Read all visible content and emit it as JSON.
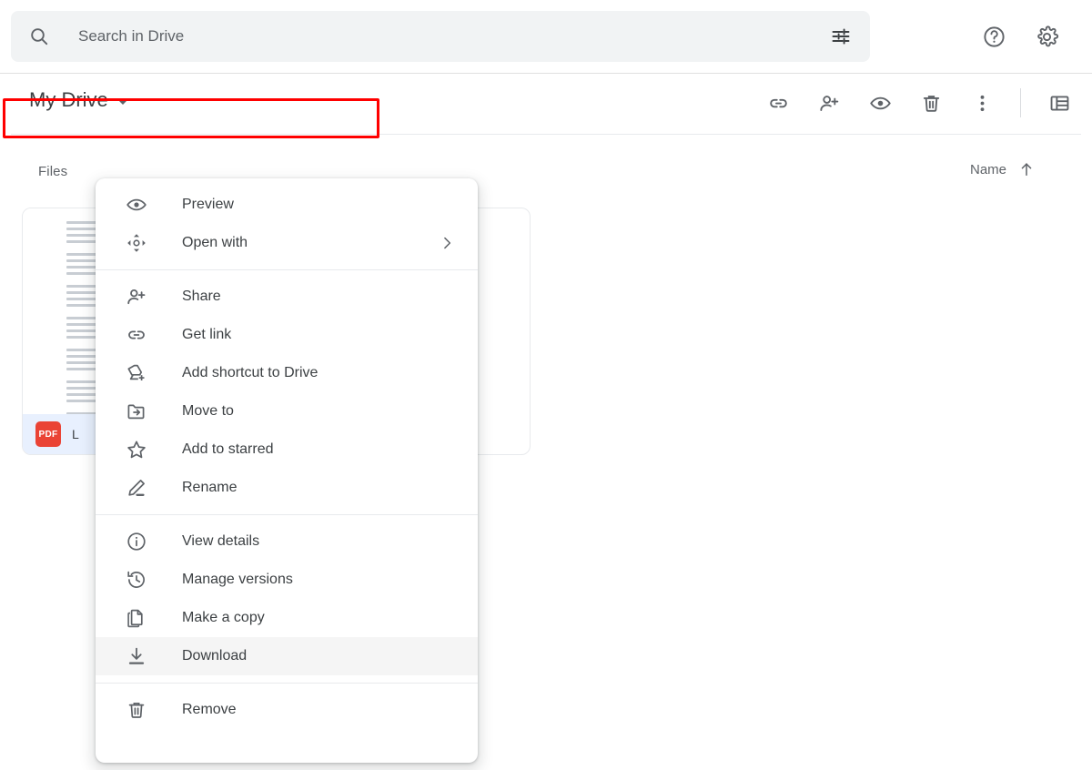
{
  "search": {
    "placeholder": "Search in Drive",
    "value": "",
    "icon": "search-icon",
    "filter_icon": "tune-filter-icon"
  },
  "header_actions": [
    {
      "name": "help-icon",
      "label": "Help"
    },
    {
      "name": "settings-icon",
      "label": "Settings"
    }
  ],
  "toolbar": {
    "breadcrumb": "My Drive",
    "caret_icon": "chevron-down-icon",
    "actions": [
      {
        "name": "get-link-icon",
        "label": "Get link"
      },
      {
        "name": "share-person-add-icon",
        "label": "Share"
      },
      {
        "name": "preview-eye-icon",
        "label": "Preview"
      },
      {
        "name": "trash-icon",
        "label": "Remove"
      },
      {
        "name": "more-vertical-icon",
        "label": "More actions"
      },
      {
        "name": "list-view-icon",
        "label": "List view"
      }
    ]
  },
  "content": {
    "section_title": "Files",
    "sort": {
      "label": "Name",
      "direction_icon": "arrow-up-icon"
    }
  },
  "files": [
    {
      "name": "L",
      "type_badge": "PDF",
      "selected": true,
      "thumbnail_paragraphs": [
        4,
        4,
        4,
        4,
        4,
        4,
        4,
        1
      ]
    },
    {
      "name": "",
      "type_badge": "",
      "selected": false,
      "thumbnail_paragraphs": []
    }
  ],
  "context_menu": {
    "groups": [
      {
        "items": [
          {
            "label": "Preview",
            "icon": "preview-eye-icon",
            "submenu": false
          },
          {
            "label": "Open with",
            "icon": "open-with-move-icon",
            "submenu": true
          }
        ]
      },
      {
        "items": [
          {
            "label": "Share",
            "icon": "share-person-add-icon",
            "submenu": false,
            "highlighted": true
          },
          {
            "label": "Get link",
            "icon": "link-icon",
            "submenu": false
          },
          {
            "label": "Add shortcut to Drive",
            "icon": "add-shortcut-icon",
            "submenu": false
          },
          {
            "label": "Move to",
            "icon": "move-to-folder-icon",
            "submenu": false
          },
          {
            "label": "Add to starred",
            "icon": "star-icon",
            "submenu": false
          },
          {
            "label": "Rename",
            "icon": "pencil-edit-icon",
            "submenu": false
          }
        ]
      },
      {
        "items": [
          {
            "label": "View details",
            "icon": "info-circle-icon",
            "submenu": false
          },
          {
            "label": "Manage versions",
            "icon": "history-clock-icon",
            "submenu": false
          },
          {
            "label": "Make a copy",
            "icon": "copy-icon",
            "submenu": false
          },
          {
            "label": "Download",
            "icon": "download-icon",
            "submenu": false,
            "hovered": true
          }
        ]
      },
      {
        "items": [
          {
            "label": "Remove",
            "icon": "trash-icon",
            "submenu": false
          }
        ]
      }
    ],
    "submenu_arrow_icon": "chevron-right-icon"
  },
  "annotation": {
    "highlight_color": "#ff0000",
    "highlight_target": "Share"
  }
}
